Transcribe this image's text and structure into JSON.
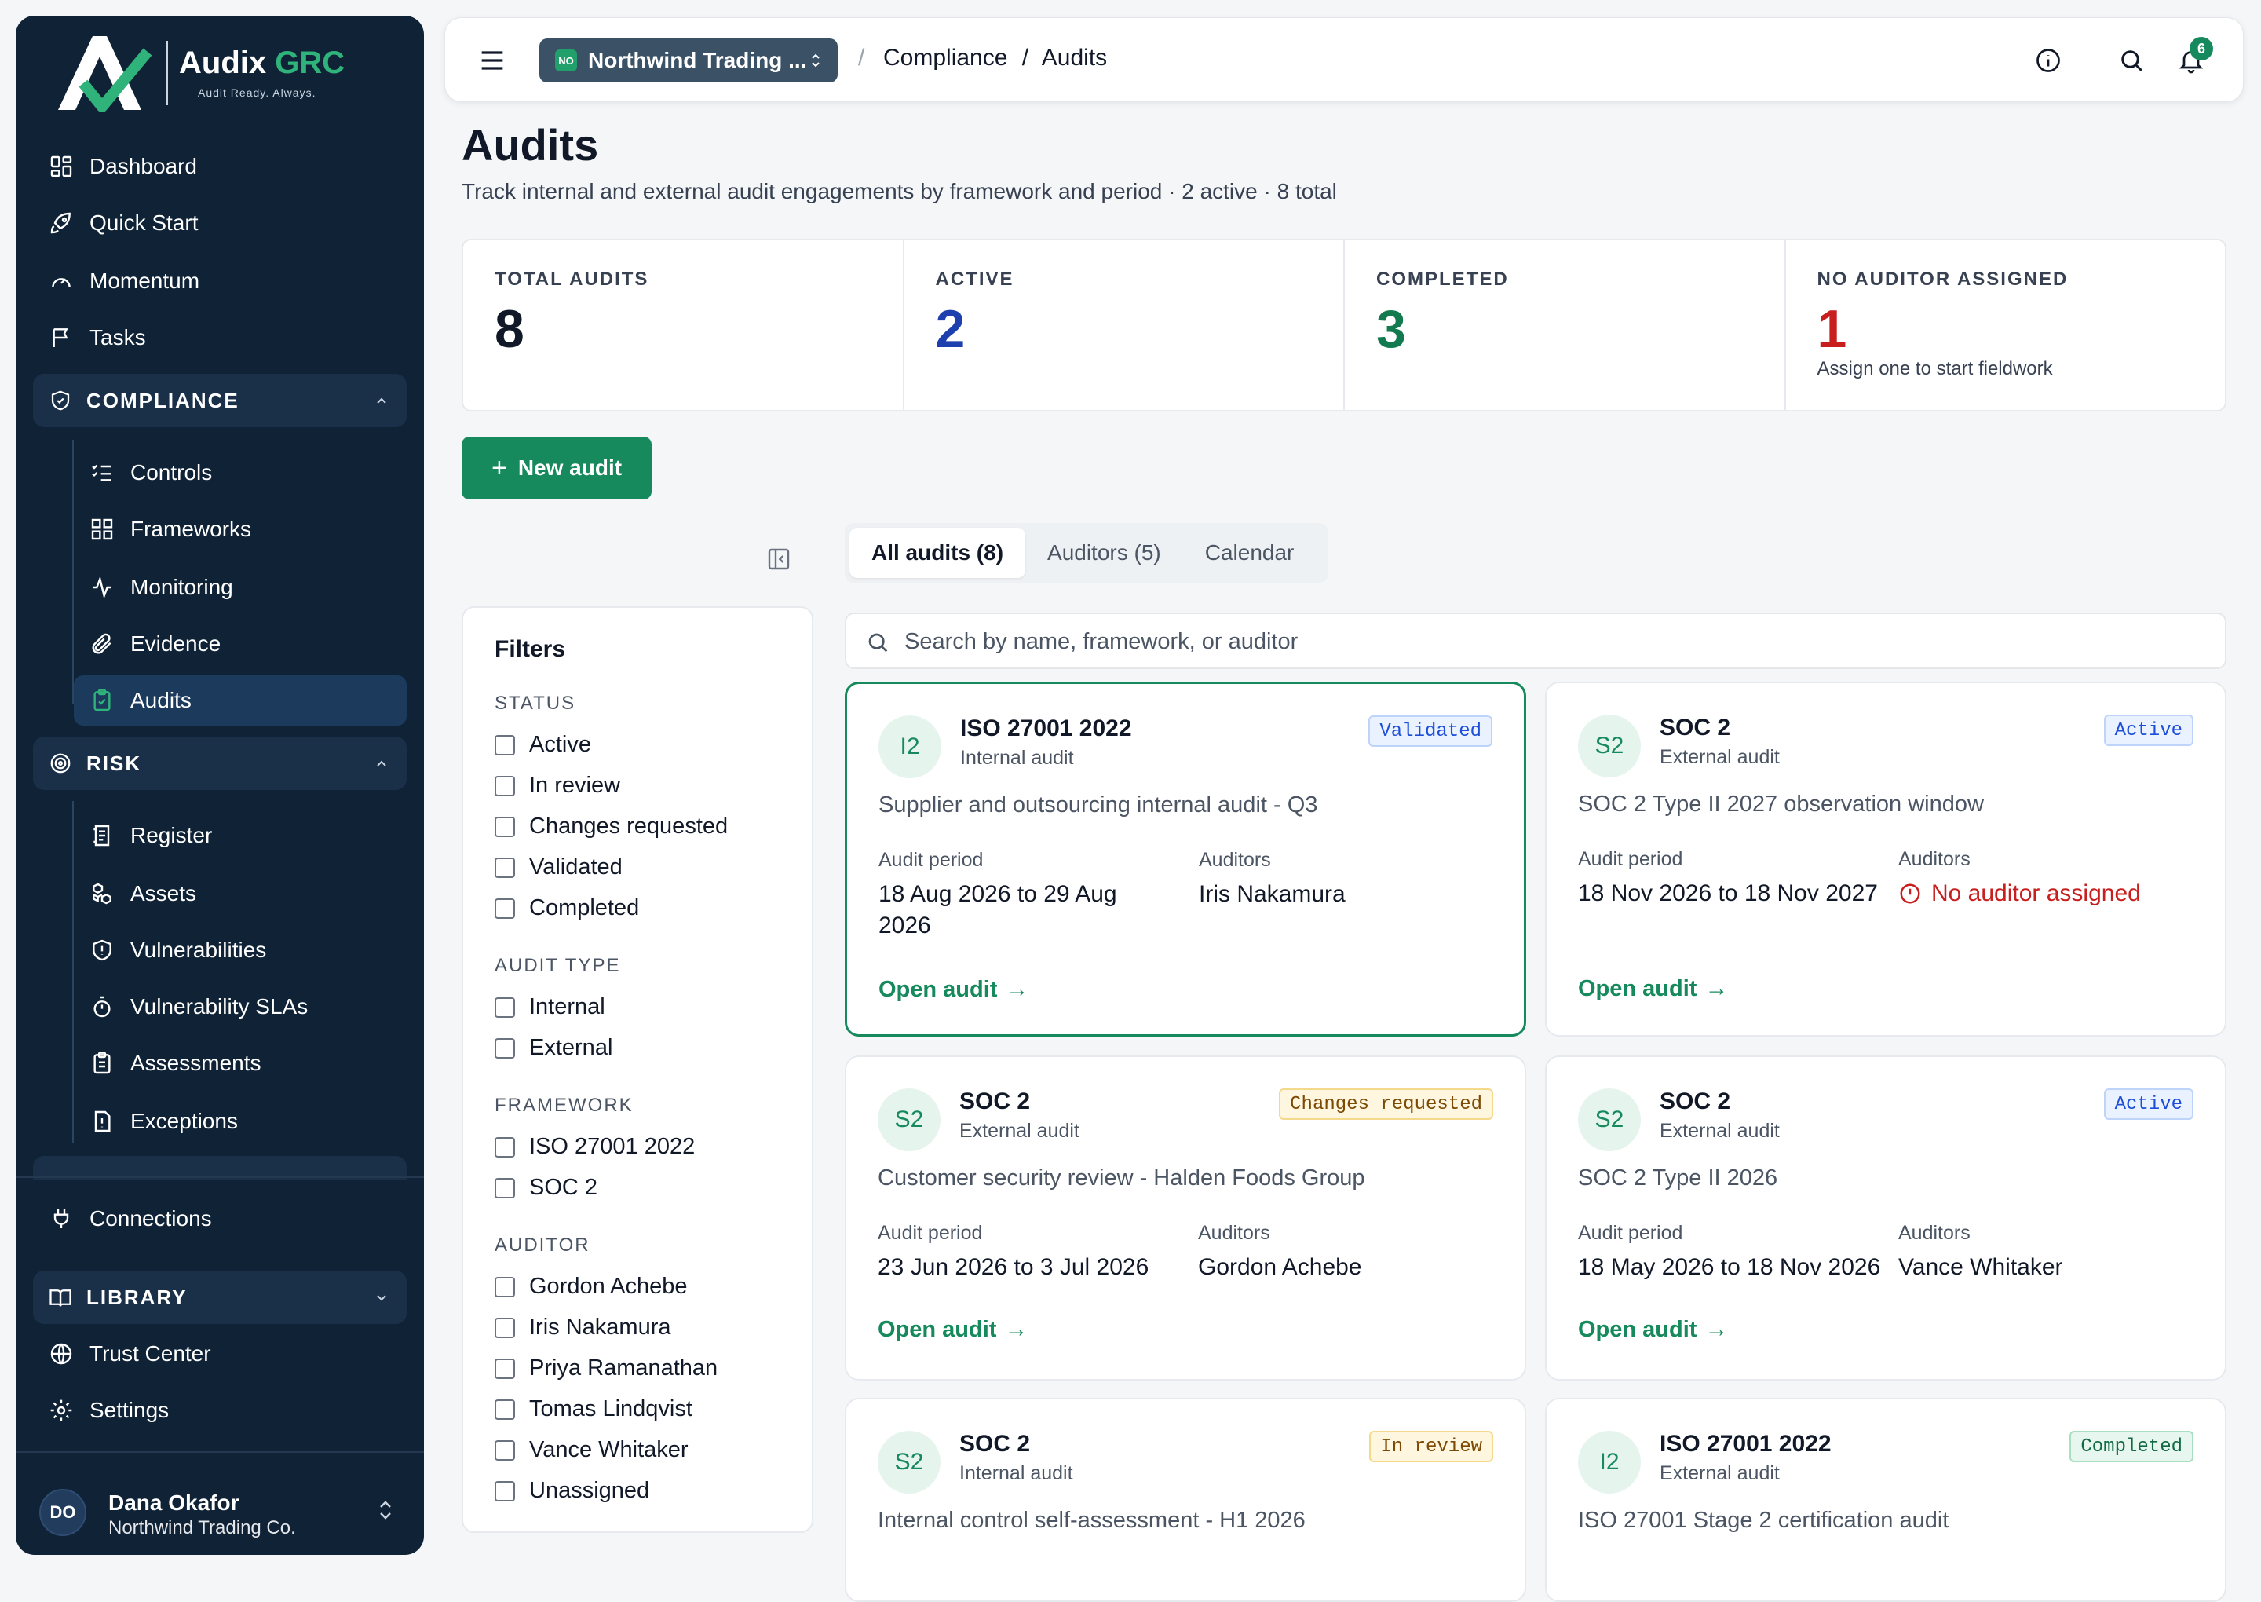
{
  "app": {
    "brand_main": "Audix",
    "brand_accent": "GRC",
    "tagline": "Audit Ready. Always."
  },
  "sidebar": {
    "top_items": [
      {
        "label": "Dashboard",
        "icon": "dashboard-icon"
      },
      {
        "label": "Quick Start",
        "icon": "rocket-icon"
      },
      {
        "label": "Momentum",
        "icon": "gauge-icon"
      },
      {
        "label": "Tasks",
        "icon": "flag-icon"
      }
    ],
    "compliance": {
      "label": "COMPLIANCE",
      "items": [
        {
          "label": "Controls",
          "icon": "list-checks-icon"
        },
        {
          "label": "Frameworks",
          "icon": "grid-icon"
        },
        {
          "label": "Monitoring",
          "icon": "activity-icon"
        },
        {
          "label": "Evidence",
          "icon": "paperclip-icon"
        },
        {
          "label": "Audits",
          "icon": "clipboard-check-icon"
        }
      ]
    },
    "risk": {
      "label": "RISK",
      "items": [
        {
          "label": "Register",
          "icon": "register-icon"
        },
        {
          "label": "Assets",
          "icon": "boxes-icon"
        },
        {
          "label": "Vulnerabilities",
          "icon": "shield-alert-icon"
        },
        {
          "label": "Vulnerability SLAs",
          "icon": "timer-icon"
        },
        {
          "label": "Assessments",
          "icon": "clipboard-list-icon"
        },
        {
          "label": "Exceptions",
          "icon": "file-exclamation-icon"
        }
      ]
    },
    "connections": "Connections",
    "library": {
      "label": "LIBRARY"
    },
    "bottom_items": [
      {
        "label": "Trust Center",
        "icon": "globe-icon"
      },
      {
        "label": "Settings",
        "icon": "gear-icon"
      }
    ],
    "user": {
      "initials": "DO",
      "name": "Dana Okafor",
      "org": "Northwind Trading Co."
    }
  },
  "topbar": {
    "org_badge": "NO",
    "org_name": "Northwind Trading ...",
    "breadcrumb": [
      "Compliance",
      "Audits"
    ],
    "notification_count": "6"
  },
  "page": {
    "title": "Audits",
    "subtitle": "Track internal and external audit engagements by framework and period · 2 active · 8 total"
  },
  "stats": [
    {
      "label": "TOTAL AUDITS",
      "value": "8",
      "color": "#111827",
      "note": ""
    },
    {
      "label": "ACTIVE",
      "value": "2",
      "color": "#1e40af",
      "note": ""
    },
    {
      "label": "COMPLETED",
      "value": "3",
      "color": "#137a4f",
      "note": ""
    },
    {
      "label": "NO AUDITOR ASSIGNED",
      "value": "1",
      "color": "#c81e1e",
      "note": "Assign one to start fieldwork"
    }
  ],
  "actions": {
    "new_audit": "New audit"
  },
  "tabs": [
    "All audits (8)",
    "Auditors (5)",
    "Calendar"
  ],
  "search": {
    "placeholder": "Search by name, framework, or auditor"
  },
  "filters": {
    "title": "Filters",
    "groups": [
      {
        "label": "STATUS",
        "options": [
          "Active",
          "In review",
          "Changes requested",
          "Validated",
          "Completed"
        ]
      },
      {
        "label": "AUDIT TYPE",
        "options": [
          "Internal",
          "External"
        ]
      },
      {
        "label": "FRAMEWORK",
        "options": [
          "ISO 27001 2022",
          "SOC 2"
        ]
      },
      {
        "label": "AUDITOR",
        "options": [
          "Gordon Achebe",
          "Iris Nakamura",
          "Priya Ramanathan",
          "Tomas Lindqvist",
          "Vance Whitaker",
          "Unassigned"
        ]
      }
    ]
  },
  "card_labels": {
    "period": "Audit period",
    "auditors": "Auditors",
    "open": "Open audit"
  },
  "audits": [
    {
      "avatar": "I2",
      "framework": "ISO 27001 2022",
      "type": "Internal audit",
      "status": "Validated",
      "name": "Supplier and outsourcing internal audit - Q3",
      "period": "18 Aug 2026 to 29 Aug 2026",
      "auditors": "Iris Nakamura"
    },
    {
      "avatar": "S2",
      "framework": "SOC 2",
      "type": "External audit",
      "status": "Active",
      "name": "SOC 2 Type II 2027 observation window",
      "period": "18 Nov 2026 to 18 Nov 2027",
      "auditors": "No auditor assigned"
    },
    {
      "avatar": "S2",
      "framework": "SOC 2",
      "type": "External audit",
      "status": "Changes requested",
      "name": "Customer security review - Halden Foods Group",
      "period": "23 Jun 2026 to 3 Jul 2026",
      "auditors": "Gordon Achebe"
    },
    {
      "avatar": "S2",
      "framework": "SOC 2",
      "type": "External audit",
      "status": "Active",
      "name": "SOC 2 Type II 2026",
      "period": "18 May 2026 to 18 Nov 2026",
      "auditors": "Vance Whitaker"
    },
    {
      "avatar": "S2",
      "framework": "SOC 2",
      "type": "Internal audit",
      "status": "In review",
      "name": "Internal control self-assessment - H1 2026",
      "period": "",
      "auditors": ""
    },
    {
      "avatar": "I2",
      "framework": "ISO 27001 2022",
      "type": "External audit",
      "status": "Completed",
      "name": "ISO 27001 Stage 2 certification audit",
      "period": "",
      "auditors": ""
    }
  ]
}
